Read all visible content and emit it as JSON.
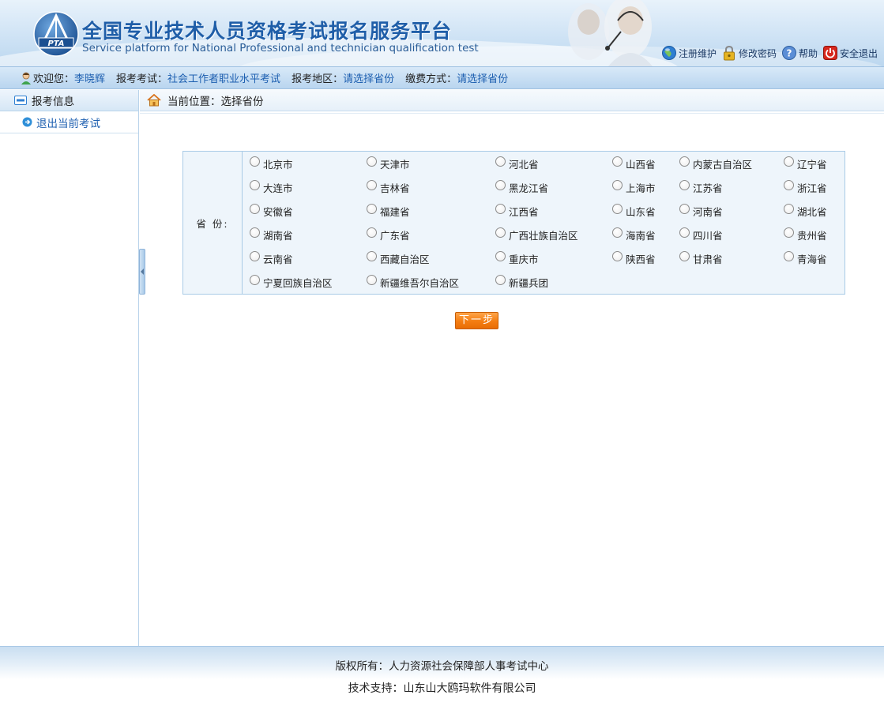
{
  "header": {
    "title_cn": "全国专业技术人员资格考试报名服务平台",
    "title_en": "Service platform for National Professional and technician qualification test",
    "logo_text": "PTA",
    "links": [
      {
        "label": "注册维护",
        "icon": "globe-icon"
      },
      {
        "label": "修改密码",
        "icon": "lock-icon"
      },
      {
        "label": "帮助",
        "icon": "help-icon"
      },
      {
        "label": "安全退出",
        "icon": "power-icon"
      }
    ]
  },
  "welcome": {
    "welcome_label": "欢迎您：",
    "user_name": "李晓辉",
    "exam_label": "报考考试：",
    "exam_value": "社会工作者职业水平考试",
    "region_label": "报考地区：",
    "region_value": "请选择省份",
    "pay_label": "缴费方式：",
    "pay_value": "请选择省份"
  },
  "sidebar": {
    "heading": "报考信息",
    "items": [
      {
        "label": "退出当前考试"
      }
    ]
  },
  "breadcrumb": {
    "text": "当前位置：选择省份"
  },
  "province_form": {
    "label": "省  份:",
    "options": [
      "北京市",
      "天津市",
      "河北省",
      "山西省",
      "内蒙古自治区",
      "辽宁省",
      "大连市",
      "吉林省",
      "黑龙江省",
      "上海市",
      "江苏省",
      "浙江省",
      "安徽省",
      "福建省",
      "江西省",
      "山东省",
      "河南省",
      "湖北省",
      "湖南省",
      "广东省",
      "广西壮族自治区",
      "海南省",
      "四川省",
      "贵州省",
      "云南省",
      "西藏自治区",
      "重庆市",
      "陕西省",
      "甘肃省",
      "青海省",
      "宁夏回族自治区",
      "新疆维吾尔自治区",
      "新疆兵团"
    ],
    "selected": null
  },
  "next_button": {
    "label": "下一步"
  },
  "footer": {
    "copyright": "版权所有：人力资源社会保障部人事考试中心",
    "support": "技术支持：山东山大鸥玛软件有限公司"
  },
  "colors": {
    "brand_blue": "#1f5ea8",
    "link_blue": "#1d5fb0",
    "button_orange": "#f47d12",
    "panel_bg": "#eef5fb"
  }
}
